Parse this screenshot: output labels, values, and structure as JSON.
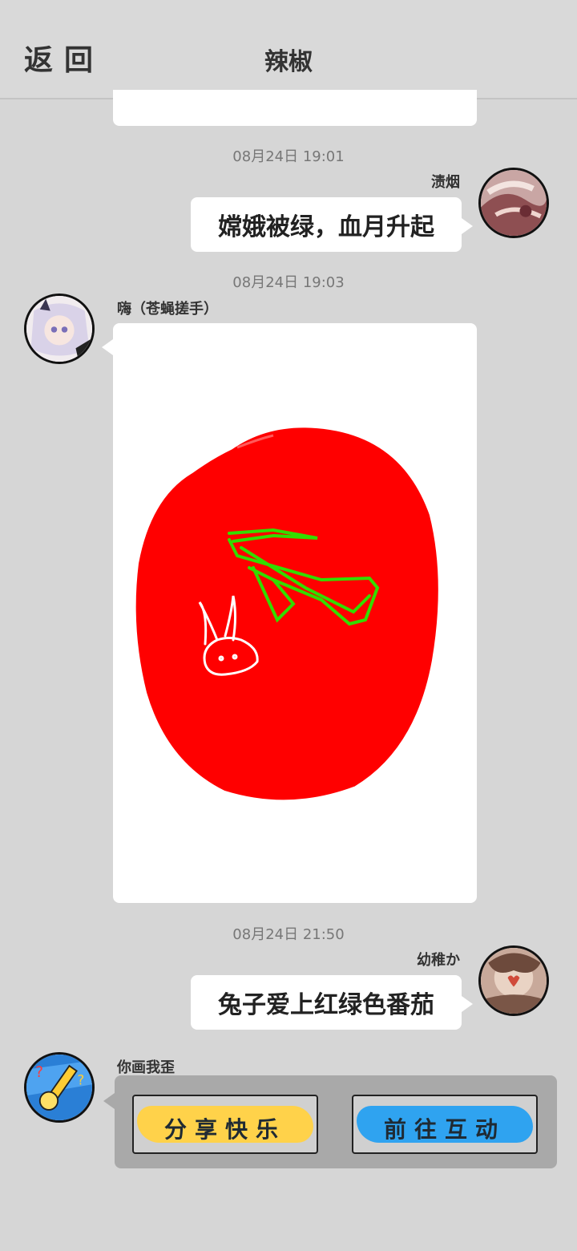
{
  "header": {
    "back_label": "返回",
    "title": "辣椒"
  },
  "colors": {
    "background": "#d6d6d6",
    "bubble": "#ffffff",
    "tomato": "#ff0000",
    "stroke_green": "#33dd00",
    "share_yellow": "#ffd24a",
    "go_blue": "#2fa3f0"
  },
  "messages": [
    {
      "timestamp": "08月24日  19:01",
      "sender": "渍烟",
      "text": "嫦娥被绿，血月升起",
      "side": "right"
    },
    {
      "timestamp": "08月24日  19:03",
      "sender": "嗨（苍蝇搓手）",
      "type": "drawing",
      "side": "left",
      "image": "red-tomato-drawing"
    },
    {
      "timestamp": "08月24日  21:50",
      "sender": "幼稚か",
      "text": "兔子爱上红绿色番茄",
      "side": "right"
    },
    {
      "sender": "你画我歪",
      "type": "game-card",
      "side": "left"
    }
  ],
  "game_card": {
    "share_label": "分享快乐",
    "go_label": "前往互动"
  }
}
